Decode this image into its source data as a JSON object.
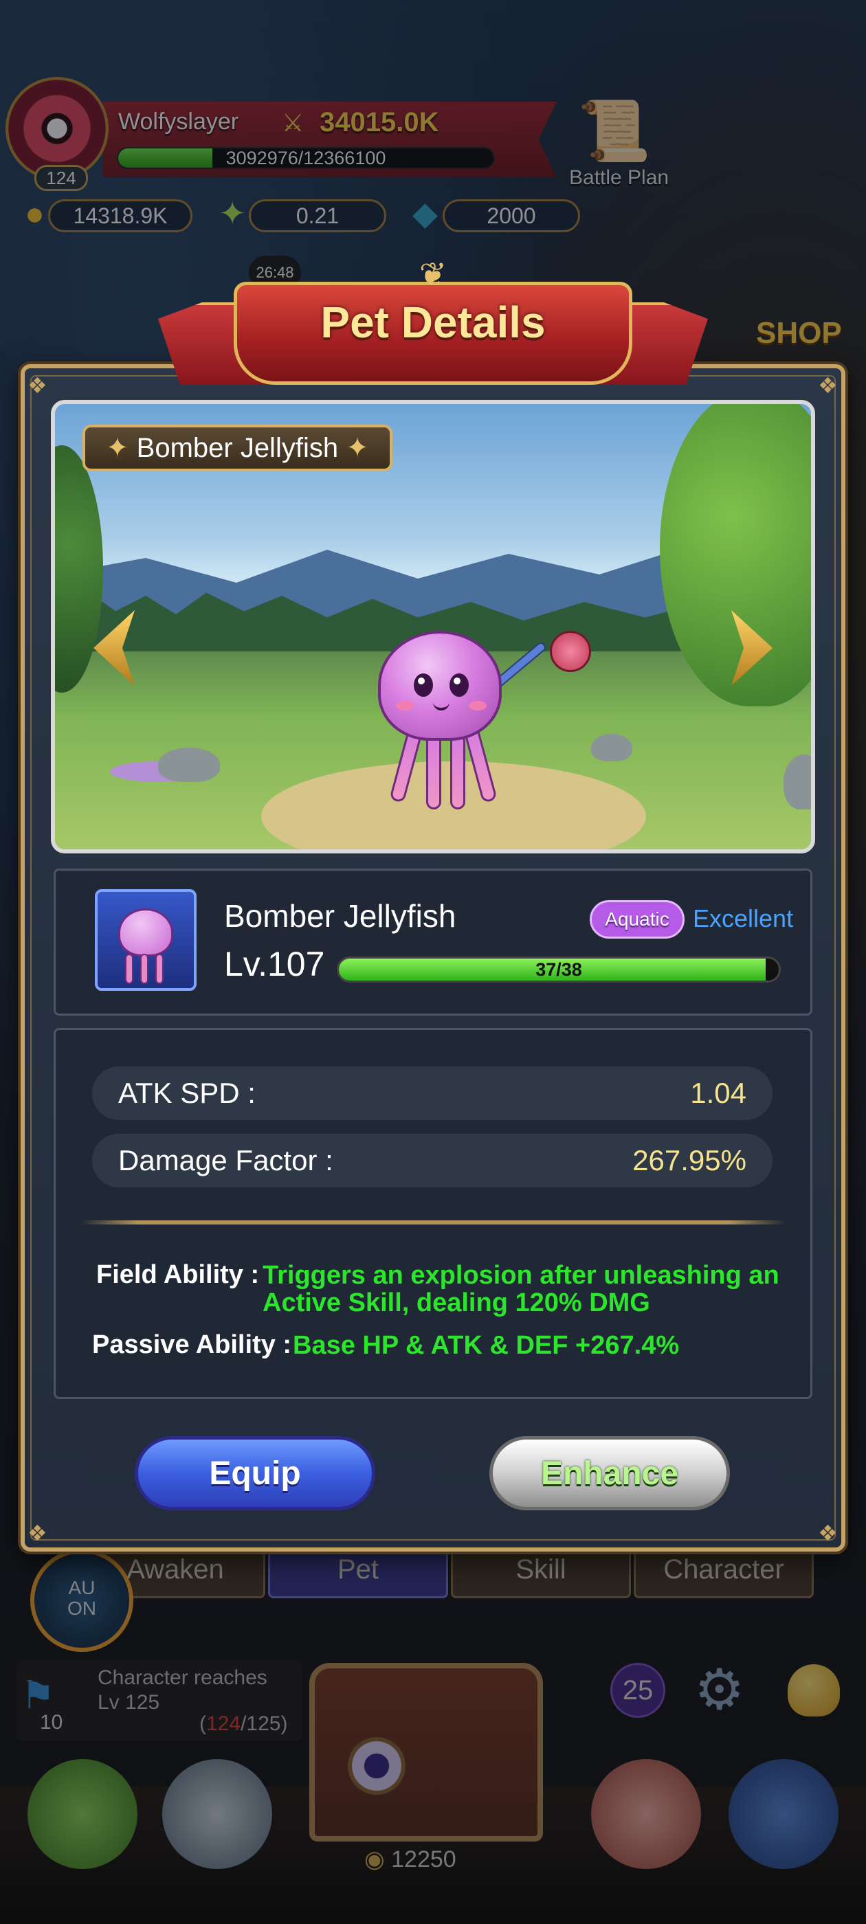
{
  "hud": {
    "player_name": "Wolfyslayer",
    "player_level": "124",
    "combat_power": "34015.0K",
    "xp_text": "3092976/12366100",
    "xp_fraction": 0.25,
    "gold": "14318.9K",
    "star_currency": "0.21",
    "gems": "2000",
    "battle_plan_label": "Battle Plan",
    "timer": "26:48",
    "shop_label": "SHOP"
  },
  "modal": {
    "title": "Pet Details",
    "preview": {
      "pet_name_tag": "Bomber Jellyfish"
    },
    "info": {
      "pet_name": "Bomber Jellyfish",
      "type_badge": "Aquatic",
      "quality": "Excellent",
      "level": "Lv.107",
      "level_progress_text": "37/38",
      "level_progress_fraction": 0.97
    },
    "stats": [
      {
        "label": "ATK SPD :",
        "value": "1.04"
      },
      {
        "label": "Damage Factor :",
        "value": "267.95%"
      }
    ],
    "abilities": {
      "field_label": "Field Ability :",
      "field_line1": "Triggers an explosion after unleashing an",
      "field_line2": "Active Skill, dealing 120% DMG",
      "passive_label": "Passive Ability :",
      "passive_text": "Base HP & ATK & DEF +267.4%"
    },
    "buttons": {
      "equip": "Equip",
      "enhance": "Enhance"
    }
  },
  "bottom": {
    "tabs": [
      "Awaken",
      "Pet",
      "Skill",
      "Character"
    ],
    "auto_label_1": "AU",
    "auto_label_2": "ON",
    "quest_title_1": "Character reaches",
    "quest_title_2": "Lv 125",
    "quest_level": "10",
    "quest_current": "124",
    "quest_total": "/125)",
    "quest_open_paren": "(",
    "notification_count": "25",
    "coins": "12250"
  },
  "colors": {
    "accent_gold": "#c6a263",
    "ability_green": "#2be62b",
    "quality_blue": "#4aa3ff",
    "type_purple": "#b65be8"
  }
}
